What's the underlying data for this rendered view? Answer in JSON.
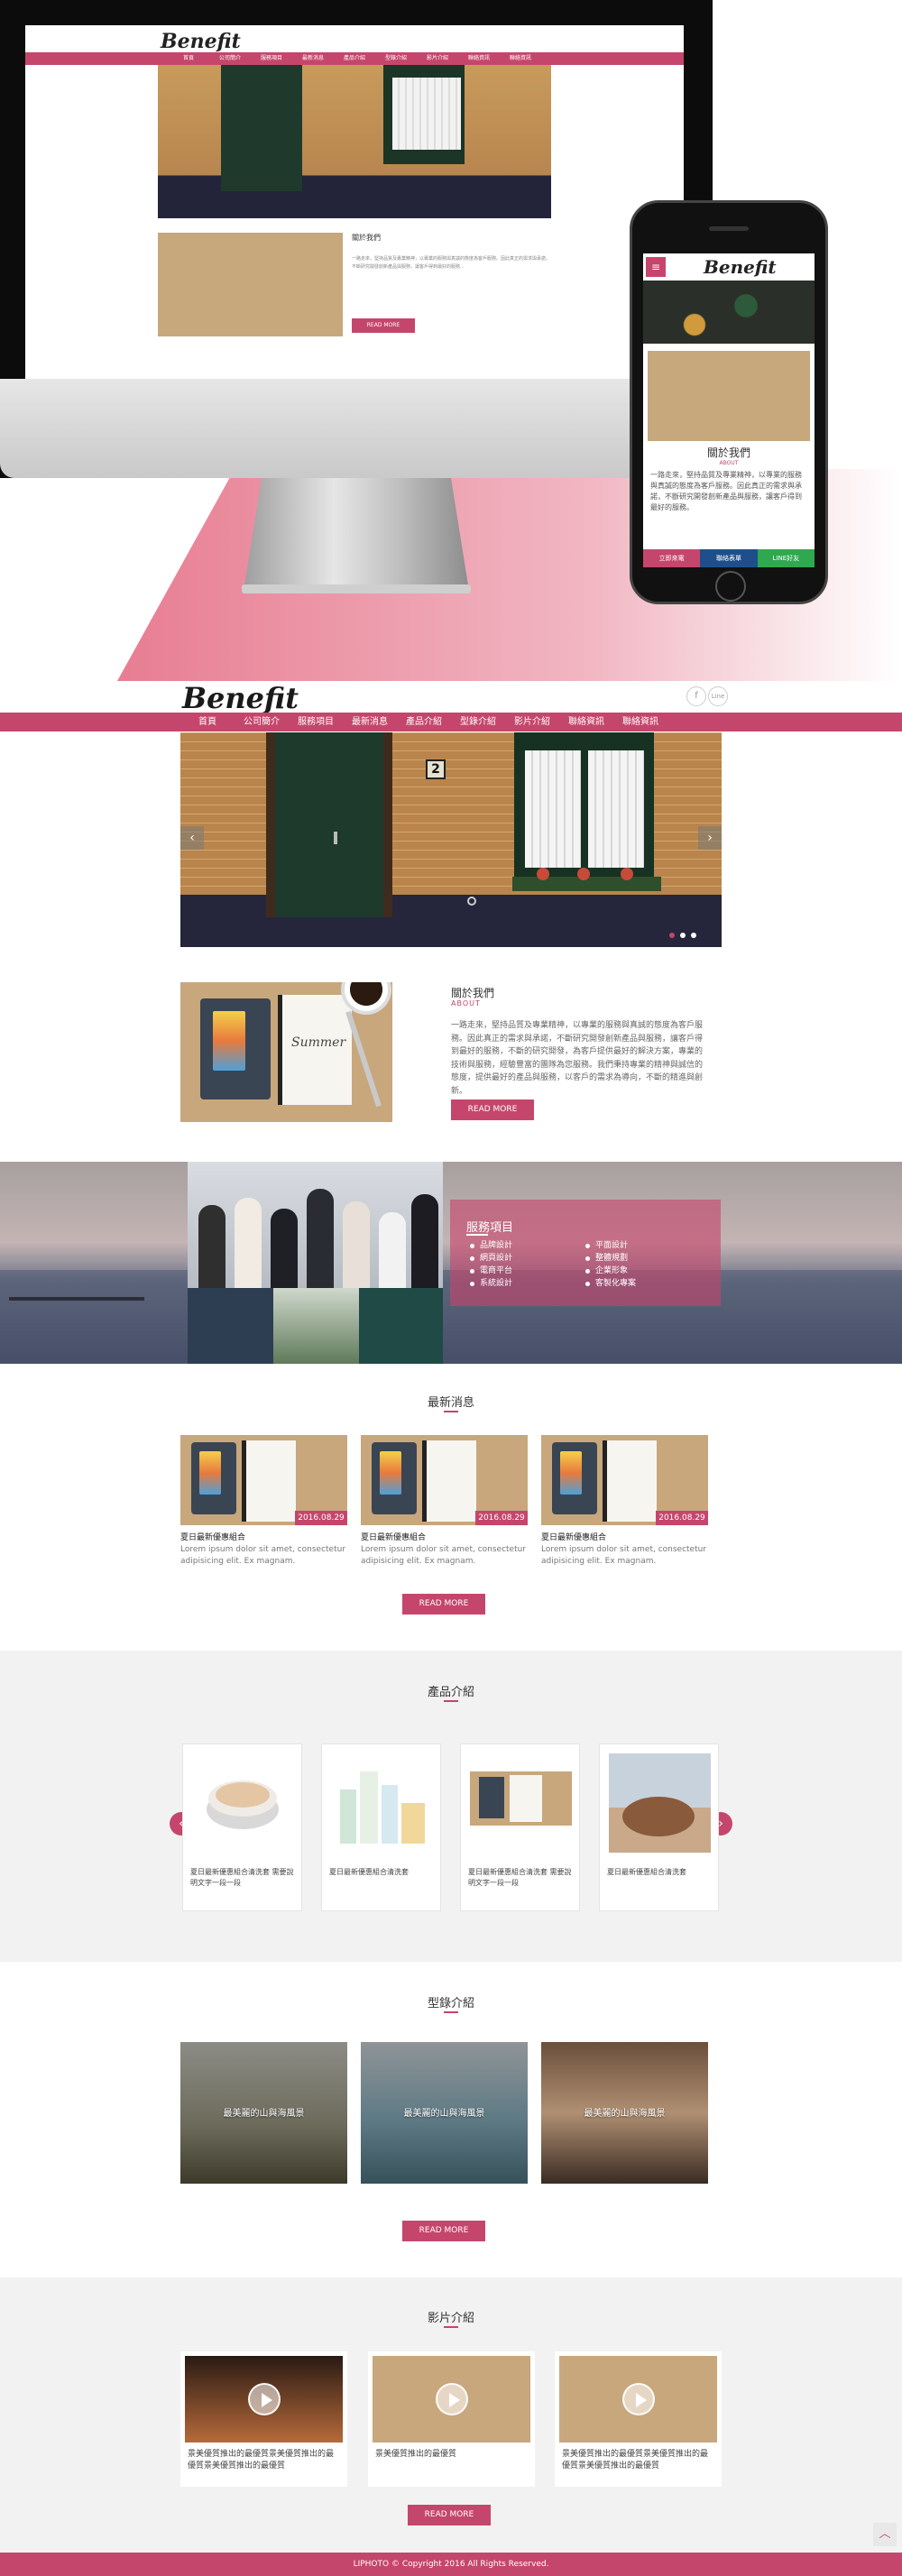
{
  "mockup": {
    "mini_logo": "Benefit",
    "mini_nav": [
      "首頁",
      "公司簡介",
      "服務項目",
      "最新消息",
      "產品介紹",
      "型錄介紹",
      "影片介紹",
      "聯絡資訊",
      "聯絡資訊"
    ],
    "mini_about_title": "關於我們",
    "mini_about_text": "一路走來，堅持品質及專業精神，以專業的服務與真誠的態度為客戶服務。因此真正的需求與承諾，不斷研究開發創新產品與服務，讓客戶得到最好的服務...",
    "mini_about_btn": "READ MORE",
    "phone_menu": "≡",
    "phone_logo": "Benefit",
    "phone_about_title": "關於我們",
    "phone_about_sub": "ABOUT",
    "phone_about_text": "一路走來，堅持品質及專業精神，以專業的服務與真誠的態度為客戶服務。因此真正的需求與承諾，不斷研究開發創新產品與服務，讓客戶得到最好的服務。",
    "phone_footer": [
      "立即來電",
      "聯絡表單",
      "LINE好友"
    ]
  },
  "header": {
    "logo": "Benefit",
    "social": [
      "f",
      "Line"
    ]
  },
  "nav": [
    "首頁",
    "公司簡介",
    "服務項目",
    "最新消息",
    "產品介紹",
    "型錄介紹",
    "影片介紹",
    "聯絡資訊",
    "聯絡資訊"
  ],
  "banner": {
    "house_number": "2",
    "prev_icon": "‹",
    "next_icon": "›"
  },
  "about": {
    "title": "關於我們",
    "sub": "ABOUT",
    "text": "一路走來，堅持品質及專業精神，以專業的服務與真誠的態度為客戶服務。因此真正的需求與承諾，不斷研究開發創新產品與服務，讓客戶得到最好的服務，不斷的研究開發，為客戶提供最好的解決方案，專業的技術與服務，經驗豐富的團隊為您服務。我們秉持專業的精神與誠信的態度，提供最好的產品與服務，以客戶的需求為導向，不斷的精進與創新。",
    "notebook_script": "Summer",
    "button": "READ MORE"
  },
  "services": {
    "title": "服務項目",
    "col1": [
      "品牌設計",
      "網頁設計",
      "電商平台",
      "系統設計"
    ],
    "col2": [
      "平面設計",
      "整體規劃",
      "企業形象",
      "客製化專案"
    ]
  },
  "news": {
    "title": "最新消息",
    "items": [
      {
        "date": "2016.08.29",
        "title": "夏日最新優惠組合",
        "text": "Lorem ipsum dolor sit amet, consectetur adipisicing elit. Ex magnam."
      },
      {
        "date": "2016.08.29",
        "title": "夏日最新優惠組合",
        "text": "Lorem ipsum dolor sit amet, consectetur adipisicing elit. Ex magnam."
      },
      {
        "date": "2016.08.29",
        "title": "夏日最新優惠組合",
        "text": "Lorem ipsum dolor sit amet, consectetur adipisicing elit. Ex magnam."
      }
    ],
    "button": "READ MORE"
  },
  "products": {
    "title": "產品介紹",
    "items": [
      {
        "text": "夏日最新優惠組合清洗套 需要說明文字一段一段"
      },
      {
        "text": "夏日最新優惠組合清洗套"
      },
      {
        "text": "夏日最新優惠組合清洗套 需要說明文字一段一段"
      },
      {
        "text": "夏日最新優惠組合清洗套"
      }
    ],
    "prev_icon": "‹",
    "next_icon": "›"
  },
  "cases": {
    "title": "型錄介紹",
    "items": [
      "最美麗的山與海風景",
      "最美麗的山與海風景",
      "最美麗的山與海風景"
    ],
    "button": "READ MORE"
  },
  "videos": {
    "title": "影片介紹",
    "items": [
      {
        "text": "景美優質推出的最優質景美優質推出的最優質景美優質推出的最優質"
      },
      {
        "text": "景美優質推出的最優質"
      },
      {
        "text": "景美優質推出的最優質景美優質推出的最優質景美優質推出的最優質"
      }
    ],
    "button": "READ MORE"
  },
  "footer": "LIPHOTO © Copyright 2016 All Rights Reserved.",
  "totop_icon": "︿",
  "colors": {
    "accent": "#c5466c",
    "panel": "#f2f2f2"
  }
}
